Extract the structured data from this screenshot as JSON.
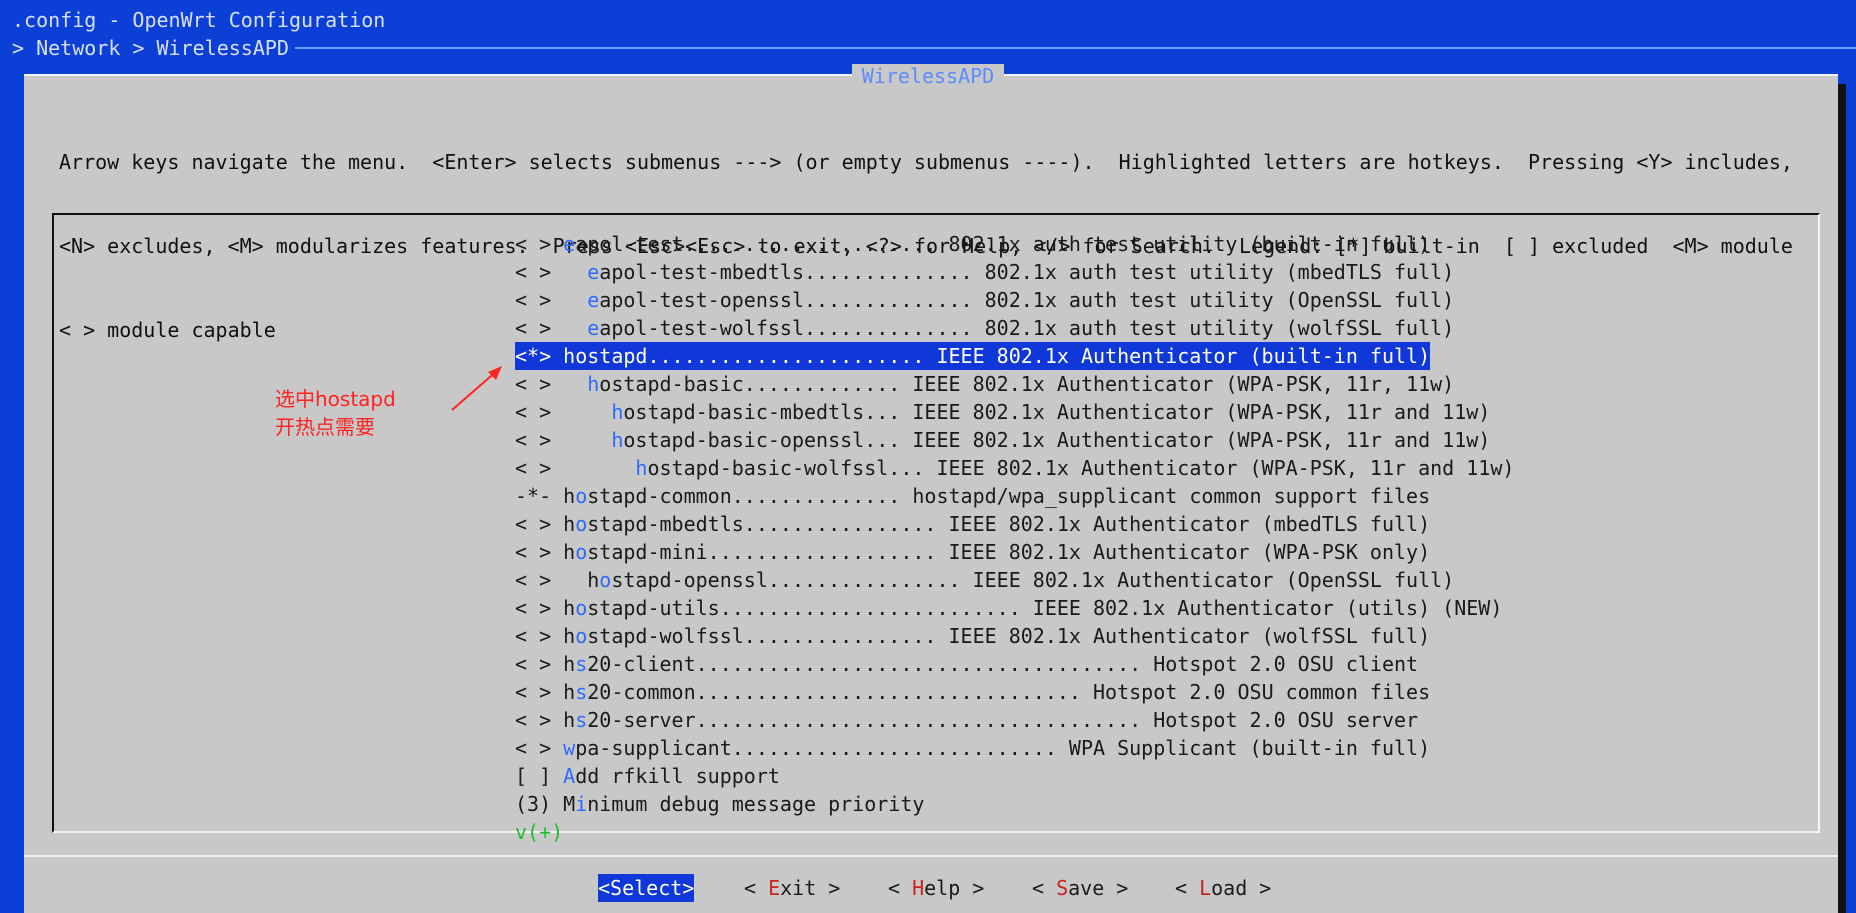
{
  "window": {
    "title": ".config - OpenWrt Configuration",
    "breadcrumb": "> Network > WirelessAPD"
  },
  "dialog": {
    "title": "WirelessAPD",
    "help_lines": [
      "Arrow keys navigate the menu.  <Enter> selects submenus ---> (or empty submenus ----).  Highlighted letters are hotkeys.  Pressing <Y> includes,",
      "<N> excludes, <M> modularizes features.  Press <Esc><Esc> to exit, <?> for Help, </> for Search.  Legend: [*] built-in  [ ] excluded  <M> module",
      "< > module capable"
    ]
  },
  "menu": {
    "items": [
      {
        "pre": "< > ",
        "hotkey": "e",
        "rest": "apol-test..................... 802.1x auth test utility (built-in full)"
      },
      {
        "pre": "< >   ",
        "hotkey": "e",
        "rest": "apol-test-mbedtls.............. 802.1x auth test utility (mbedTLS full)"
      },
      {
        "pre": "< >   ",
        "hotkey": "e",
        "rest": "apol-test-openssl.............. 802.1x auth test utility (OpenSSL full)"
      },
      {
        "pre": "< >   ",
        "hotkey": "e",
        "rest": "apol-test-wolfssl.............. 802.1x auth test utility (wolfSSL full)"
      },
      {
        "pre": "<*> ",
        "hotkey": "h",
        "rest": "ostapd....................... IEEE 802.1x Authenticator (built-in full)",
        "selected": true
      },
      {
        "pre": "< >   ",
        "hotkey": "h",
        "rest": "ostapd-basic............. IEEE 802.1x Authenticator (WPA-PSK, 11r, 11w)"
      },
      {
        "pre": "< >     ",
        "hotkey": "h",
        "rest": "ostapd-basic-mbedtls... IEEE 802.1x Authenticator (WPA-PSK, 11r and 11w)"
      },
      {
        "pre": "< >     ",
        "hotkey": "h",
        "rest": "ostapd-basic-openssl... IEEE 802.1x Authenticator (WPA-PSK, 11r and 11w)"
      },
      {
        "pre": "< >       ",
        "hotkey": "h",
        "rest": "ostapd-basic-wolfssl... IEEE 802.1x Authenticator (WPA-PSK, 11r and 11w)"
      },
      {
        "pre": "-*- h",
        "hotkey": "o",
        "rest": "stapd-common.............. hostapd/wpa_supplicant common support files"
      },
      {
        "pre": "< > h",
        "hotkey": "o",
        "rest": "stapd-mbedtls................ IEEE 802.1x Authenticator (mbedTLS full)"
      },
      {
        "pre": "< > h",
        "hotkey": "o",
        "rest": "stapd-mini................... IEEE 802.1x Authenticator (WPA-PSK only)"
      },
      {
        "pre": "< >   h",
        "hotkey": "o",
        "rest": "stapd-openssl................ IEEE 802.1x Authenticator (OpenSSL full)"
      },
      {
        "pre": "< > h",
        "hotkey": "o",
        "rest": "stapd-utils......................... IEEE 802.1x Authenticator (utils) (NEW)"
      },
      {
        "pre": "< > h",
        "hotkey": "o",
        "rest": "stapd-wolfssl................ IEEE 802.1x Authenticator (wolfSSL full)"
      },
      {
        "pre": "< > h",
        "hotkey": "s",
        "rest": "20-client..................................... Hotspot 2.0 OSU client"
      },
      {
        "pre": "< > h",
        "hotkey": "s",
        "rest": "20-common................................ Hotspot 2.0 OSU common files"
      },
      {
        "pre": "< > h",
        "hotkey": "s",
        "rest": "20-server..................................... Hotspot 2.0 OSU server"
      },
      {
        "pre": "< > ",
        "hotkey": "w",
        "rest": "pa-supplicant........................... WPA Supplicant (built-in full)"
      },
      {
        "pre": "[ ] ",
        "hotkey": "A",
        "rest": "dd rfkill support"
      },
      {
        "pre": "(3) M",
        "hotkey": "i",
        "rest": "nimum debug message priority"
      }
    ],
    "more_indicator": "v(+)"
  },
  "annotation": {
    "line1": "选中hostapd",
    "line2": "开热点需要"
  },
  "buttons": [
    {
      "pre": "<",
      "key": "S",
      "rest": "elect>",
      "active": true
    },
    {
      "pre": "< ",
      "key": "E",
      "rest": "xit >"
    },
    {
      "pre": "< ",
      "key": "H",
      "rest": "elp >"
    },
    {
      "pre": "< ",
      "key": "S",
      "rest": "ave >"
    },
    {
      "pre": "< ",
      "key": "L",
      "rest": "oad >"
    }
  ],
  "colors": {
    "background": "#0b3fd6",
    "dialog": "#c8c8c8",
    "highlight": "#1038d8",
    "hotkey": "#2f6bff",
    "annotation": "#ff2222"
  }
}
